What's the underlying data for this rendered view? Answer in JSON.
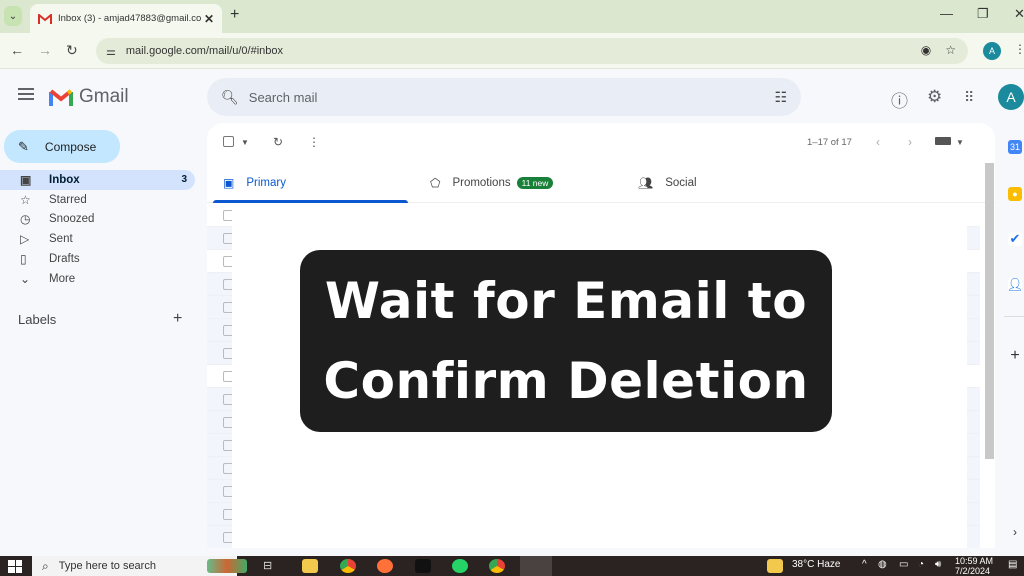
{
  "browser": {
    "tab_title": "Inbox (3) - amjad47883@gmail.co",
    "url": "mail.google.com/mail/u/0/#inbox",
    "profile_initial": "A"
  },
  "gmail": {
    "app_name": "Gmail",
    "search_placeholder": "Search mail",
    "account_initial": "A"
  },
  "sidebar": {
    "compose_label": "Compose",
    "items": [
      {
        "label": "Inbox",
        "icon": "inbox-icon",
        "count": "3",
        "active": true
      },
      {
        "label": "Starred",
        "icon": "star-icon"
      },
      {
        "label": "Snoozed",
        "icon": "clock-icon"
      },
      {
        "label": "Sent",
        "icon": "send-icon"
      },
      {
        "label": "Drafts",
        "icon": "draft-icon"
      },
      {
        "label": "More",
        "icon": "chevron-down-icon"
      }
    ],
    "labels_heading": "Labels"
  },
  "main": {
    "pagination": "1–17 of 17",
    "tabs": [
      {
        "label": "Primary",
        "icon": "inbox-icon",
        "active": true
      },
      {
        "label": "Promotions",
        "icon": "tag-icon",
        "badge": "11 new"
      },
      {
        "label": "Social",
        "icon": "people-icon"
      }
    ],
    "row_count": 15
  },
  "banner": {
    "line1": "Wait for Email to",
    "line2": "Confirm Deletion"
  },
  "taskbar": {
    "search_placeholder": "Type here to search",
    "weather": "38°C  Haze",
    "time": "10:59 AM",
    "date": "7/2/2024"
  },
  "colors": {
    "accent": "#0b57d0",
    "compose_bg": "#c2e7ff",
    "badge_green": "#188038",
    "avatar": "#1a8a9c",
    "banner_bg": "#1e1e1e"
  }
}
